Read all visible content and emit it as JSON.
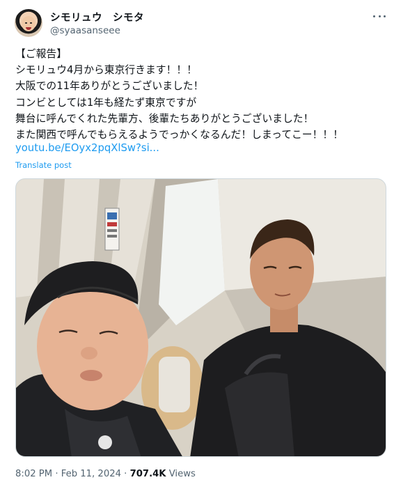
{
  "author": {
    "display_name": "シモリュウ　シモタ",
    "handle": "@syaasanseee"
  },
  "post": {
    "lines": [
      "【ご報告】",
      "シモリュウ4月から東京行きます！！！",
      "大阪での11年ありがとうございました！",
      "コンビとしては1年も経たず東京ですが",
      "舞台に呼んでくれた先輩方、後輩たちありがとうございました！",
      "また関西で呼んでもらえるようでっかくなるんだ！しまってこー！！！"
    ],
    "link": "youtu.be/EOyx2pqXlSw?si...",
    "translate": "Translate post"
  },
  "meta": {
    "time": "8:02 PM",
    "sep1": " · ",
    "date": "Feb 11, 2024",
    "sep2": " · ",
    "views_count": "707.4K",
    "views_label": " Views"
  },
  "icons": {
    "more": "more-horizontal-icon"
  }
}
